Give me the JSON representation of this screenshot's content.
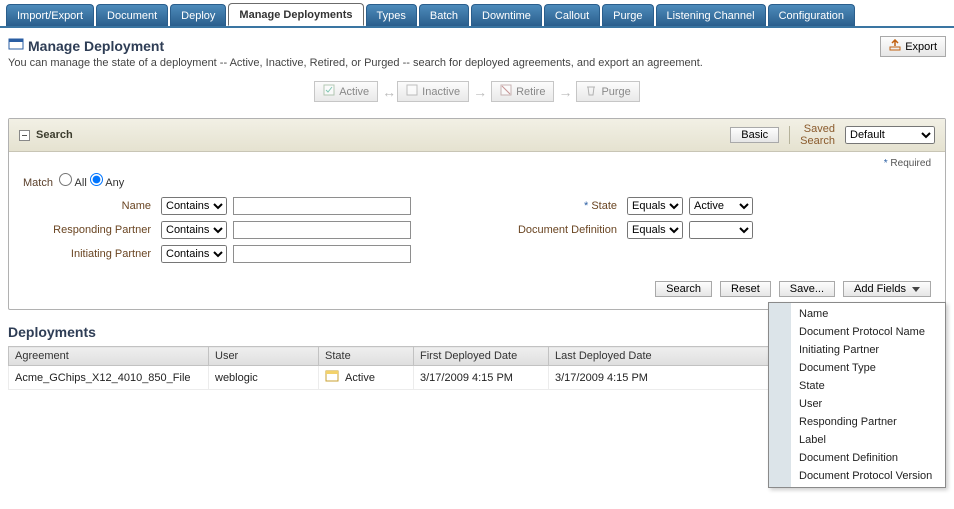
{
  "tabs": [
    "Import/Export",
    "Document",
    "Deploy",
    "Manage Deployments",
    "Types",
    "Batch",
    "Downtime",
    "Callout",
    "Purge",
    "Listening Channel",
    "Configuration"
  ],
  "activeTab": "Manage Deployments",
  "heading": {
    "title": "Manage Deployment",
    "subtitle": "You can manage the state of a deployment -- Active, Inactive, Retired, or Purged -- search for deployed agreements, and export an agreement.",
    "export": "Export"
  },
  "lifecycle": {
    "active": "Active",
    "inactive": "Inactive",
    "retire": "Retire",
    "purge": "Purge"
  },
  "search": {
    "title": "Search",
    "basic_btn": "Basic",
    "saved_label": "Saved\nSearch",
    "saved_value": "Default",
    "required": "* Required",
    "match_label": "Match",
    "match_all": "All",
    "match_any": "Any",
    "match_selected": "any",
    "labels": {
      "name": "Name",
      "responding": "Responding Partner",
      "initiating": "Initiating Partner",
      "state": "State",
      "docdef": "Document Definition"
    },
    "ops": {
      "contains": "Contains",
      "equals": "Equals"
    },
    "values": {
      "state": "Active"
    },
    "buttons": {
      "search": "Search",
      "reset": "Reset",
      "save": "Save...",
      "addfields": "Add Fields"
    }
  },
  "addfields_menu": [
    "Name",
    "Document Protocol Name",
    "Initiating Partner",
    "Document Type",
    "State",
    "User",
    "Responding Partner",
    "Label",
    "Document Definition",
    "Document Protocol Version"
  ],
  "deployments": {
    "title": "Deployments",
    "columns": [
      "Agreement",
      "User",
      "State",
      "First Deployed Date",
      "Last Deployed Date"
    ],
    "rows": [
      {
        "agreement": "Acme_GChips_X12_4010_850_File",
        "user": "weblogic",
        "state": "Active",
        "first": "3/17/2009 4:15 PM",
        "last": "3/17/2009 4:15 PM"
      }
    ]
  }
}
